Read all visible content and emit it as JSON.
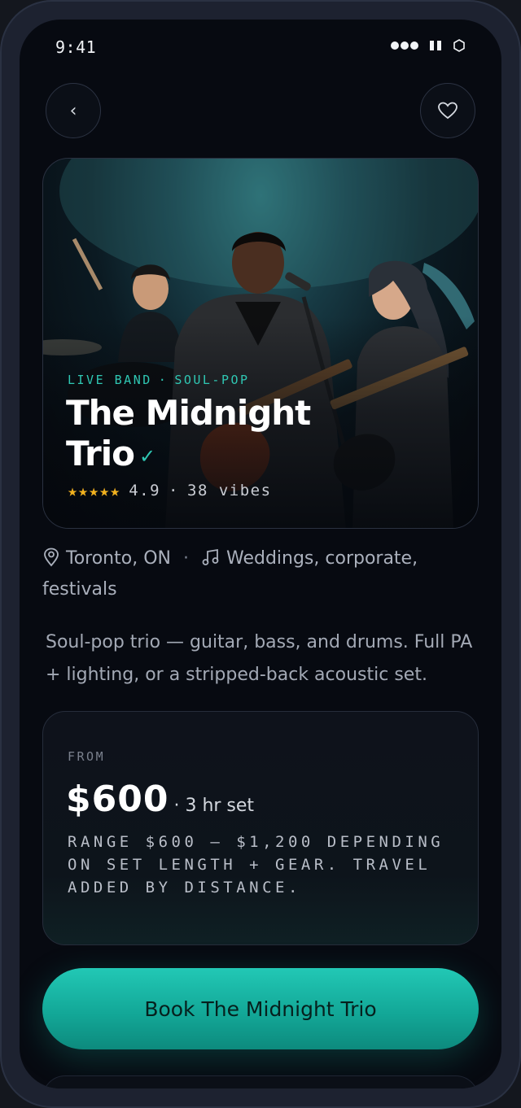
{
  "status_bar": {
    "time": "9:41"
  },
  "nav": {
    "back_glyph": "‹",
    "back_icon": "chevron-left-icon",
    "favorite_icon": "heart-outline-icon"
  },
  "hero": {
    "tag_primary": "LIVE BAND",
    "tag_separator": "·",
    "tag_secondary": "SOUL-POP",
    "title_line1": "The Midnight",
    "title_line2": "Trio",
    "verified_glyph": "✓",
    "stars": "★★★★★",
    "rating": "4.9",
    "rating_separator": "·",
    "vibes": "38 vibes",
    "accent_color": "#2fc7b3",
    "star_color": "#f2b21f"
  },
  "meta": {
    "location": "Toronto, ON",
    "separator": "·",
    "events": "Weddings, corporate, festivals"
  },
  "description": "Soul-pop trio — guitar, bass, and drums. Full PA + lighting, or a stripped-back acoustic set.",
  "pricing": {
    "from_label": "FROM",
    "price": "$600",
    "unit": "· 3 hr set",
    "range_note": "RANGE $600 – $1,200 DEPENDING ON SET LENGTH + GEAR. TRAVEL ADDED BY DISTANCE."
  },
  "cta": {
    "label": "Book The Midnight Trio",
    "color": "#1bb8a6"
  }
}
